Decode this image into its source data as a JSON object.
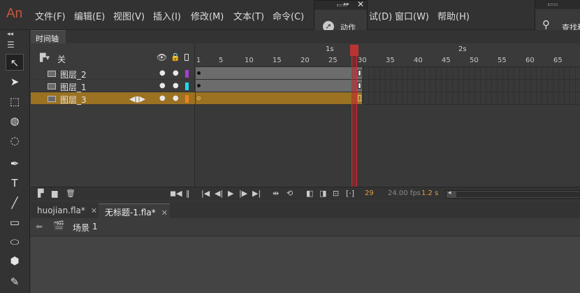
{
  "app": {
    "logo": "An"
  },
  "menu": [
    "文件(F)",
    "编辑(E)",
    "视图(V)",
    "插入(I)",
    "修改(M)",
    "文本(T)",
    "命令(C)",
    "试(D)",
    "窗口(W)",
    "帮助(H)"
  ],
  "panels": {
    "actions": "动作",
    "find": "查找和"
  },
  "timeline": {
    "tab": "时间轴",
    "header_label": "关",
    "layers": [
      {
        "name": "图层_2",
        "color": "#a040d0",
        "selected": false
      },
      {
        "name": "图层_1",
        "color": "#20d8e8",
        "selected": false
      },
      {
        "name": "图层_3",
        "color": "#f08020",
        "selected": true
      }
    ],
    "ruler_numbers": [
      "1",
      "5",
      "10",
      "15",
      "20",
      "25",
      "30",
      "35",
      "40",
      "45",
      "50",
      "55",
      "60",
      "65"
    ],
    "ruler_seconds": [
      "1s",
      "2s"
    ],
    "current_frame": "29",
    "fps": "24.00 fps",
    "time": "1.2 s"
  },
  "documents": [
    {
      "name": "huojian.fla*",
      "active": false
    },
    {
      "name": "无标题-1.fla*",
      "active": true
    }
  ],
  "scene": {
    "label": "场景",
    "number": "1"
  }
}
